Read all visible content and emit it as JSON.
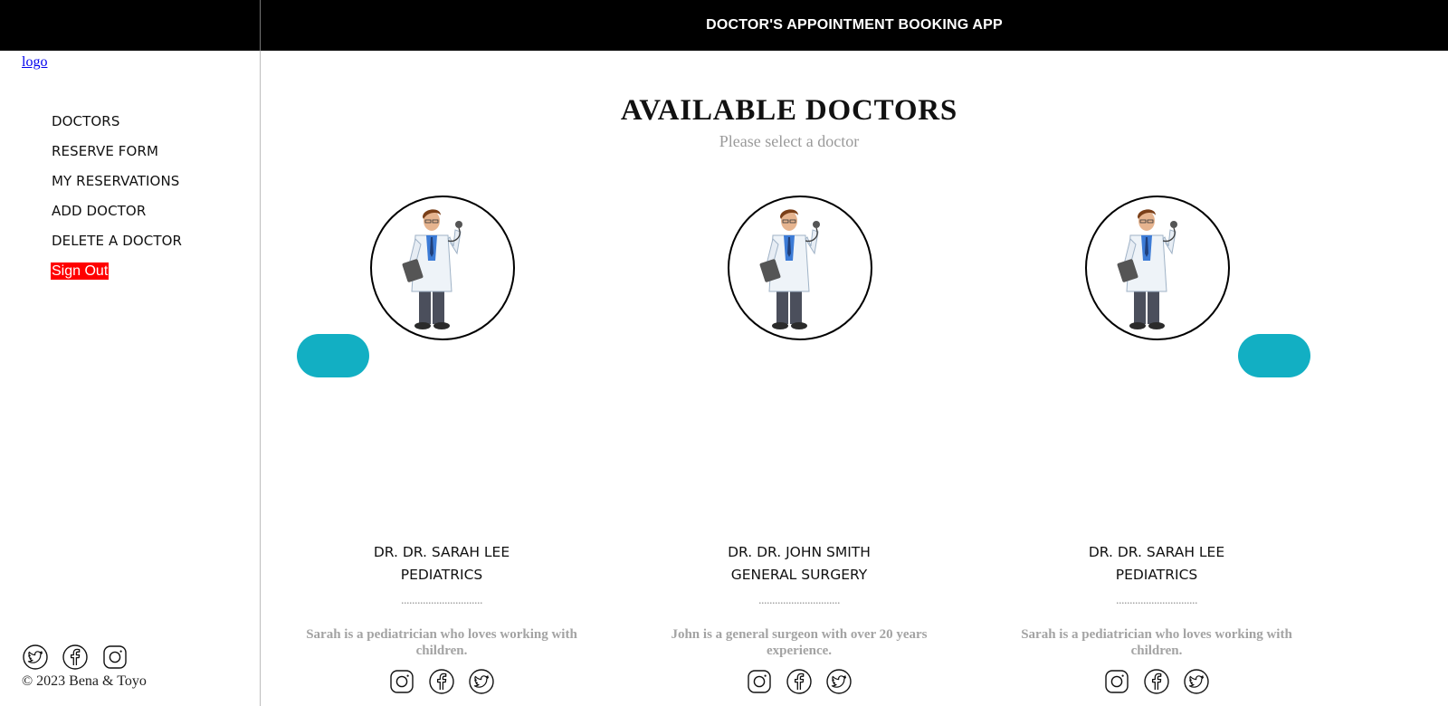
{
  "header": {
    "title": "DOCTOR'S APPOINTMENT BOOKING APP"
  },
  "sidebar": {
    "logo_alt": "logo",
    "nav": [
      {
        "label": "DOCTORS"
      },
      {
        "label": "RESERVE FORM"
      },
      {
        "label": "MY RESERVATIONS"
      },
      {
        "label": "ADD DOCTOR"
      },
      {
        "label": "DELETE A DOCTOR"
      }
    ],
    "signout_label": "Sign Out",
    "social_icons": [
      "twitter-icon",
      "facebook-icon",
      "instagram-icon"
    ],
    "copyright": "© 2023 Bena & Toyo"
  },
  "main": {
    "title": "AVAILABLE DOCTORS",
    "subtitle": "Please select a doctor",
    "prev_button": {
      "icon": "arrow-left-icon",
      "glyph": ""
    },
    "next_button": {
      "icon": "arrow-right-icon",
      "glyph": ""
    },
    "doctors": [
      {
        "name": "DR. DR. SARAH LEE",
        "specialty": "PEDIATRICS",
        "dots": "..............................",
        "bio": "Sarah is a pediatrician who loves working with children."
      },
      {
        "name": "DR. DR. JOHN SMITH",
        "specialty": "GENERAL SURGERY",
        "dots": "..............................",
        "bio": "John is a general surgeon with over 20 years experience."
      },
      {
        "name": "DR. DR. SARAH LEE",
        "specialty": "PEDIATRICS",
        "dots": "..............................",
        "bio": "Sarah is a pediatrician who loves working with children."
      }
    ],
    "card_social_icons": [
      "instagram-icon",
      "facebook-icon",
      "twitter-icon"
    ]
  },
  "colors": {
    "header_bg": "#000000",
    "accent": "#12afc3",
    "signout_bg": "#ff0000",
    "muted_text": "#9a9a9a"
  }
}
